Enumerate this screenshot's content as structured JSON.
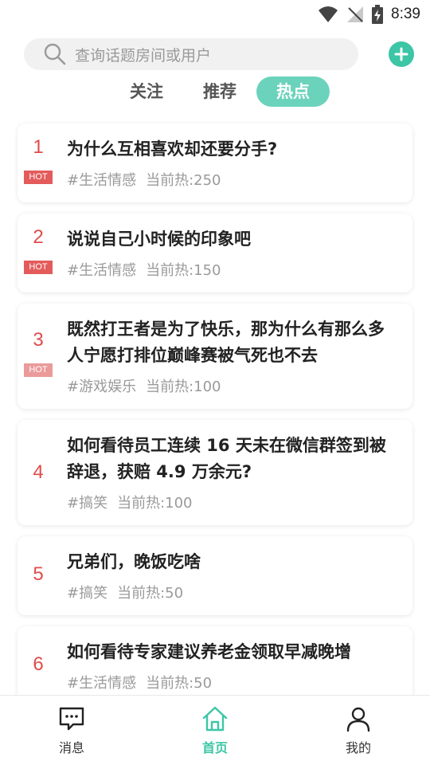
{
  "status": {
    "time": "8:39"
  },
  "search": {
    "placeholder": "查询话题房间或用户"
  },
  "tabs": [
    {
      "label": "关注",
      "active": false
    },
    {
      "label": "推荐",
      "active": false
    },
    {
      "label": "热点",
      "active": true
    }
  ],
  "items": [
    {
      "rank": "1",
      "badge": "HOT",
      "title": "为什么互相喜欢却还要分手?",
      "tag": "#生活情感",
      "heat": "当前热:250"
    },
    {
      "rank": "2",
      "badge": "HOT",
      "title": "说说自己小时候的印象吧",
      "tag": "#生活情感",
      "heat": "当前热:150"
    },
    {
      "rank": "3",
      "badge": "HOT",
      "title": "既然打王者是为了快乐，那为什么有那么多人宁愿打排位巅峰赛被气死也不去",
      "tag": "#游戏娱乐",
      "heat": "当前热:100"
    },
    {
      "rank": "4",
      "badge": "",
      "title": "如何看待员工连续 16 天未在微信群签到被辞退，获赔 4.9 万余元?",
      "tag": "#搞笑",
      "heat": "当前热:100"
    },
    {
      "rank": "5",
      "badge": "",
      "title": "兄弟们，晚饭吃啥",
      "tag": "#搞笑",
      "heat": "当前热:50"
    },
    {
      "rank": "6",
      "badge": "",
      "title": "如何看待专家建议养老金领取早减晚增",
      "tag": "#生活情感",
      "heat": "当前热:50"
    }
  ],
  "nav": [
    {
      "label": "消息",
      "icon": "message-icon"
    },
    {
      "label": "首页",
      "icon": "home-icon"
    },
    {
      "label": "我的",
      "icon": "user-icon"
    }
  ],
  "colors": {
    "accent": "#3cc6a6",
    "rank": "#e04b4b",
    "hot": "#e35b5b"
  }
}
